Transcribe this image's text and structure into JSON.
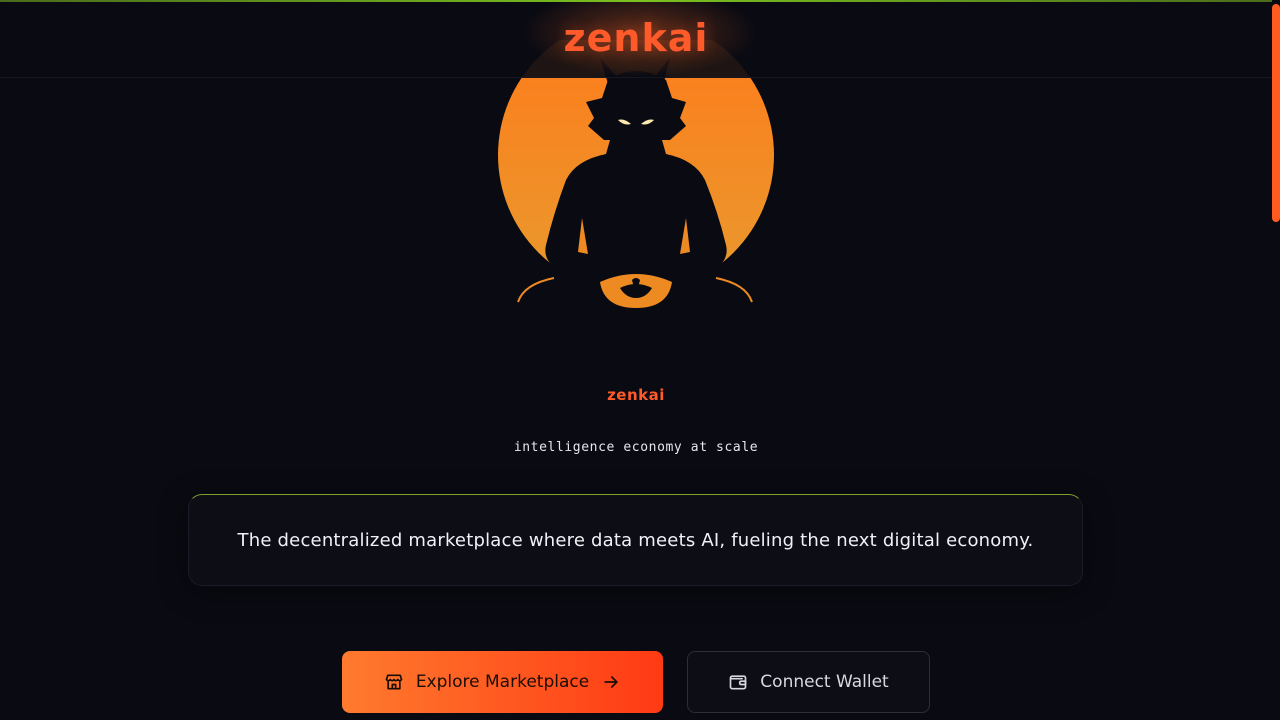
{
  "header": {
    "brand": "zenkai"
  },
  "hero": {
    "sub_brand": "zenkai",
    "tagline": "intelligence economy at scale",
    "description": "The decentralized marketplace where data meets AI, fueling the next digital economy."
  },
  "actions": {
    "primary_label": "Explore Marketplace",
    "primary_icon": "store-icon",
    "primary_trailing_icon": "arrow-right-icon",
    "secondary_label": "Connect Wallet",
    "secondary_icon": "wallet-icon"
  },
  "colors": {
    "accent": "#ff5a2a",
    "sun": "#f5a02a",
    "background": "#0a0b12",
    "highlight_line": "#7bc21f"
  }
}
